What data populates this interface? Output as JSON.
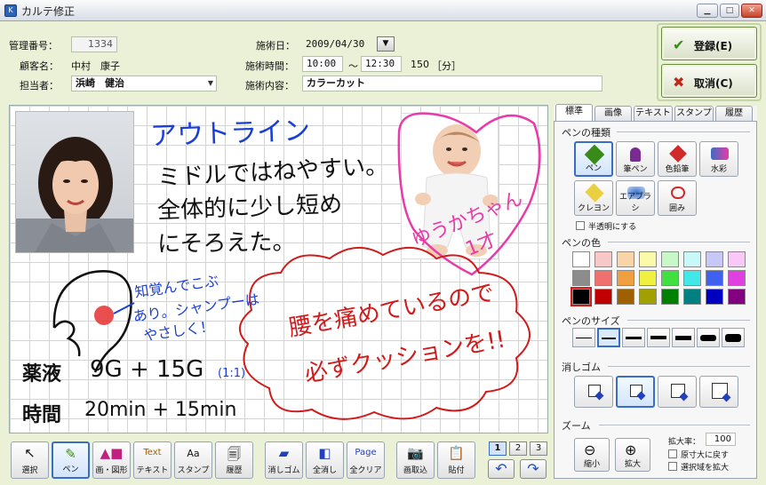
{
  "window": {
    "title": "カルテ修正",
    "icon": "app-icon",
    "controls": [
      "minimize",
      "maximize",
      "close"
    ]
  },
  "header": {
    "mgmt_label": "管理番号：",
    "mgmt_value": "1334",
    "customer_label": "顧客名：",
    "customer_value": "中村　康子",
    "staff_label": "担当者：",
    "staff_value": "浜崎　健治",
    "date_label": "施術日：",
    "date_value": "2009/04/30",
    "time_label": "施術時間：",
    "time_start": "10:00",
    "time_sep": "～",
    "time_end": "12:30",
    "duration": "150",
    "duration_unit": "［分］",
    "content_label": "施術内容：",
    "content_value": "カラーカット"
  },
  "actions": {
    "register": "登録(E)",
    "cancel": "取消(C)"
  },
  "canvas_text": {
    "outline": "アウトライン",
    "line1": "ミドルではねやすい。",
    "line2": "全体的に少し短め",
    "line3": "にそろえた。",
    "baby_note1": "ゆうかちゃん",
    "baby_note2": "1才",
    "scalp1": "知覚んでこぶ",
    "scalp2": "あり。シャンプーは",
    "scalp3": "やさしく！",
    "drug_label": "薬液",
    "drug_value": "9G + 15G",
    "drug_ratio": "(1:1)",
    "time_label": "時間",
    "time_value": "20min + 15min",
    "back1": "腰を痛めているので",
    "back2": "必ずクッションを!!"
  },
  "right_panel": {
    "tabs": [
      "標準",
      "画像",
      "テキスト",
      "スタンプ",
      "履歴"
    ],
    "pen_type_label": "ペンの種類",
    "pens": [
      "ペン",
      "筆ペン",
      "色鉛筆",
      "水彩",
      "クレヨン",
      "エアブラシ",
      "囲み"
    ],
    "semitransparent": "半透明にする",
    "pen_color_label": "ペンの色",
    "colors": [
      "#ffffff",
      "#f8c8c8",
      "#f8d4a8",
      "#fafaa8",
      "#c8f8c8",
      "#c8f8f8",
      "#c8c8f8",
      "#f8c8f8",
      "#8c8c8c",
      "#f07070",
      "#f0a040",
      "#f0f040",
      "#40e040",
      "#40e8e8",
      "#4060f0",
      "#e040e0",
      "#000000",
      "#c00000",
      "#a06000",
      "#a0a000",
      "#008000",
      "#008080",
      "#0000c0",
      "#800080"
    ],
    "pen_size_label": "ペンのサイズ",
    "sizes": [
      1,
      2,
      3,
      4,
      5,
      7,
      9
    ],
    "eraser_label": "消しゴム",
    "zoom_label": "ズーム",
    "zoom_out": "縮小",
    "zoom_in": "拡大",
    "zoom_rate_label": "拡大率：",
    "zoom_rate": "100",
    "opt_stretch": "原寸大に戻す",
    "opt_select": "選択域を拡大"
  },
  "toolbar": {
    "buttons": [
      "選択",
      "ペン",
      "画・図形",
      "テキスト",
      "スタンプ",
      "履歴",
      "消しゴム",
      "全消し",
      "全クリア",
      "画取込",
      "貼付"
    ],
    "pages": [
      "1",
      "2",
      "3"
    ]
  },
  "colors": {
    "blue_ink": "#1a3fd6",
    "red_ink": "#d11a1a",
    "pink_ink": "#e83aa8",
    "black_ink": "#111111"
  }
}
